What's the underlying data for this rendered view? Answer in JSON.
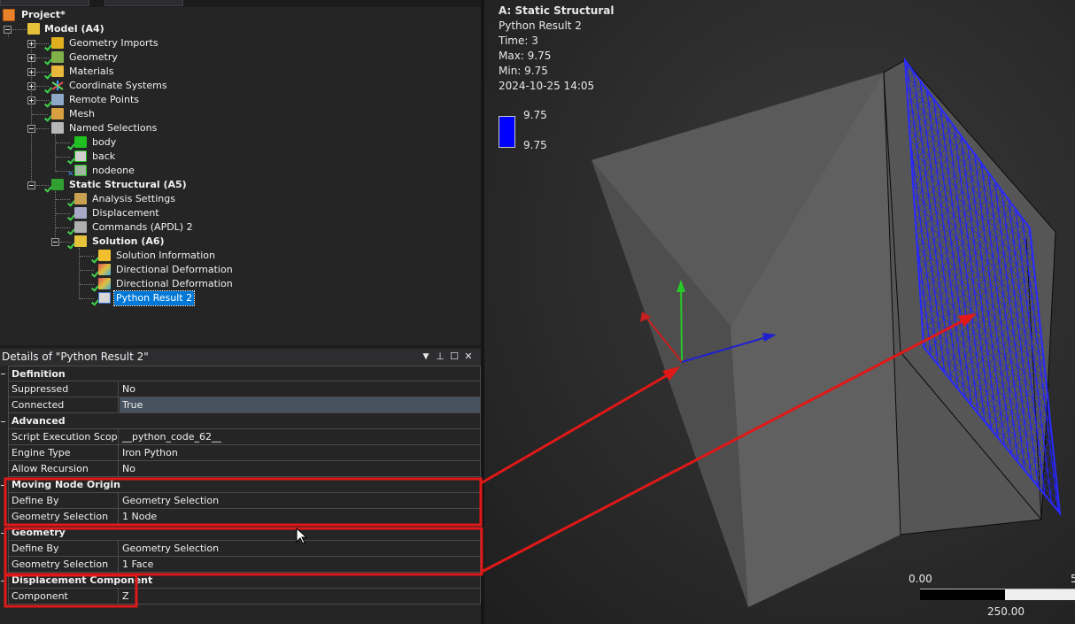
{
  "tree": {
    "project": "Project*",
    "items": [
      {
        "label": "Model (A4)"
      },
      {
        "label": "Geometry Imports"
      },
      {
        "label": "Geometry"
      },
      {
        "label": "Materials"
      },
      {
        "label": "Coordinate Systems"
      },
      {
        "label": "Remote Points"
      },
      {
        "label": "Mesh"
      },
      {
        "label": "Named Selections"
      },
      {
        "label": "body"
      },
      {
        "label": "back"
      },
      {
        "label": "nodeone"
      },
      {
        "label": "Static Structural (A5)"
      },
      {
        "label": "Analysis Settings"
      },
      {
        "label": "Displacement"
      },
      {
        "label": "Commands (APDL) 2"
      },
      {
        "label": "Solution (A6)"
      },
      {
        "label": "Solution Information"
      },
      {
        "label": "Directional Deformation"
      },
      {
        "label": "Directional Deformation"
      },
      {
        "label": "Python Result 2"
      }
    ]
  },
  "details": {
    "title": "Details of \"Python Result 2\"",
    "groups": [
      {
        "name": "Definition",
        "rows": [
          {
            "name": "Suppressed",
            "value": "No"
          },
          {
            "name": "Connected",
            "value": "True"
          }
        ]
      },
      {
        "name": "Advanced",
        "rows": [
          {
            "name": "Script Execution Scope",
            "value": "__python_code_62__"
          },
          {
            "name": "Engine Type",
            "value": "Iron Python"
          },
          {
            "name": "Allow Recursion",
            "value": "No"
          }
        ]
      },
      {
        "name": "Moving Node Origin",
        "rows": [
          {
            "name": "Define By",
            "value": "Geometry Selection"
          },
          {
            "name": "Geometry Selection",
            "value": "1 Node"
          }
        ]
      },
      {
        "name": "Geometry",
        "rows": [
          {
            "name": "Define By",
            "value": "Geometry Selection"
          },
          {
            "name": "Geometry Selection",
            "value": "1 Face"
          }
        ]
      },
      {
        "name": "Displacement Component",
        "rows": [
          {
            "name": "Component",
            "value": "Z"
          }
        ]
      }
    ],
    "buttons": {
      "dropdown": "▼",
      "pin": "⊥",
      "maximize": "☐",
      "close": "✕"
    }
  },
  "viewport": {
    "analysis": "A: Static Structural",
    "result": "Python Result 2",
    "time": "Time: 3",
    "max": "Max: 9.75",
    "min": "Min: 9.75",
    "date": "2024-10-25 14:05",
    "legend": {
      "top": "9.75",
      "bottom": "9.75",
      "color": "#0000ff"
    },
    "scale": {
      "zero": "0.00",
      "mid": "250.00",
      "end": "5"
    }
  },
  "colors": {
    "selection": "#0078d7",
    "annotation": "#e01818",
    "mesh": "#1a1aff"
  }
}
